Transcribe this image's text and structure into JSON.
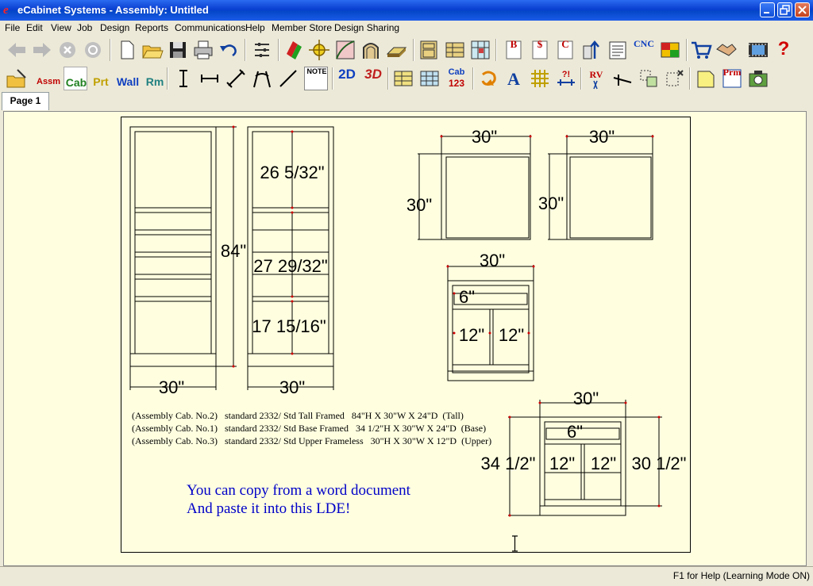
{
  "window": {
    "title": "eCabinet Systems - Assembly: Untitled"
  },
  "menu": {
    "items": [
      "File",
      "Edit",
      "View",
      "Job",
      "Design",
      "Reports",
      "Communications",
      "Help",
      "Member Store",
      "Design Sharing"
    ]
  },
  "toolbar2": {
    "assm": "Assm",
    "cab": "Cab",
    "prt": "Prt",
    "wall": "Wall",
    "rm": "Rm",
    "note": "NOTE",
    "two_d": "2D",
    "three_d": "3D",
    "cab123_top": "Cab",
    "cab123_bottom": "123",
    "rv": "RV",
    "prm": "Prm"
  },
  "toolbar1": {
    "cnc": "CNC",
    "b": "B",
    "dollar": "$",
    "c": "C",
    "help": "?"
  },
  "tabs": [
    {
      "label": "Page 1"
    }
  ],
  "drawing": {
    "tall_width": "30\"",
    "tall_height": "84\"",
    "tall_side_width": "30\"",
    "tall_upper": "26 5/32\"",
    "tall_mid": "27 29/32\"",
    "tall_lower": "17 15/16\"",
    "upper1_width": "30\"",
    "upper1_height": "30\"",
    "upper2_width": "30\"",
    "upper2_height": "30\"",
    "upper3_width": "30\"",
    "upper3_drawer": "6\"",
    "upper3_left": "12\"",
    "upper3_right": "12\"",
    "base_width": "30\"",
    "base_drawer": "6\"",
    "base_left_height": "34 1/2\"",
    "base_right_height": "30 1/2\"",
    "base_door_left": "12\"",
    "base_door_right": "12\""
  },
  "notes": [
    "(Assembly Cab. No.2)   standard 2332/ Std Tall Framed   84\"H X 30\"W X 24\"D  (Tall)",
    "(Assembly Cab. No.1)   standard 2332/ Std Base Framed   34 1/2\"H X 30\"W X 24\"D  (Base)",
    "(Assembly Cab. No.3)   standard 2332/ Std Upper Frameless   30\"H X 30\"W X 12\"D  (Upper)"
  ],
  "blue_text": [
    "You can copy from a word document",
    "And paste it into this LDE!"
  ],
  "status": {
    "text": "F1 for Help (Learning Mode ON)"
  }
}
